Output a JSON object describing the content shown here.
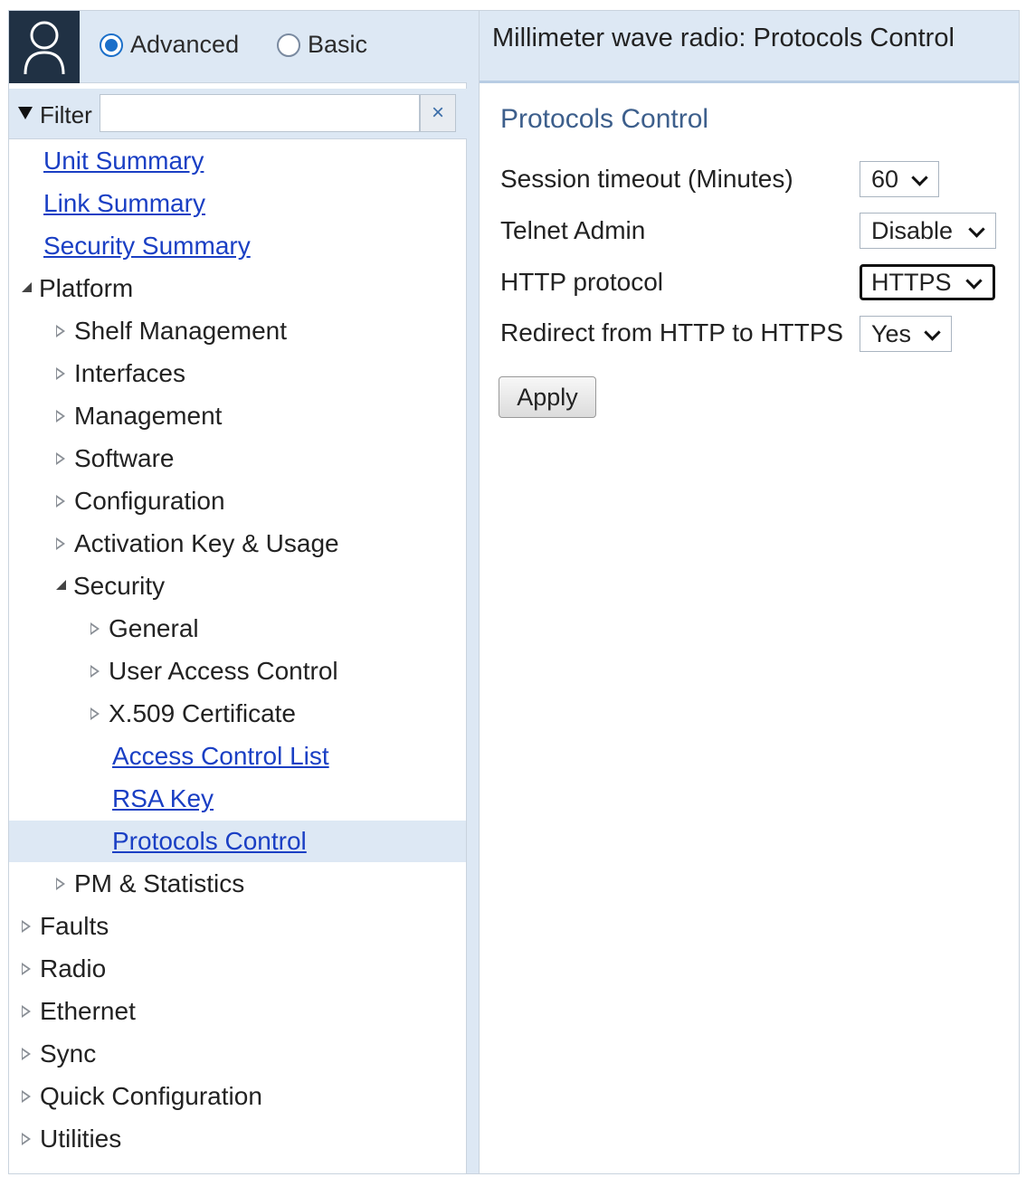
{
  "mode": {
    "advanced_label": "Advanced",
    "basic_label": "Basic",
    "selected": "Advanced"
  },
  "filter": {
    "label": "Filter",
    "value": "",
    "clear_glyph": "×"
  },
  "nav": {
    "unit_summary": "Unit Summary",
    "link_summary": "Link Summary",
    "security_summary": "Security Summary",
    "platform": "Platform",
    "shelf_management": "Shelf Management",
    "interfaces": "Interfaces",
    "management": "Management",
    "software": "Software",
    "configuration": "Configuration",
    "activation_key": "Activation Key & Usage",
    "security": "Security",
    "general": "General",
    "user_access_control": "User Access Control",
    "x509": "X.509 Certificate",
    "acl": "Access Control List",
    "rsa_key": "RSA Key",
    "protocols_control": "Protocols Control",
    "pm_statistics": "PM & Statistics",
    "faults": "Faults",
    "radio": "Radio",
    "ethernet": "Ethernet",
    "sync": "Sync",
    "quick_configuration": "Quick Configuration",
    "utilities": "Utilities",
    "selected": "Protocols Control"
  },
  "content": {
    "page_title": "Millimeter wave radio: Protocols Control",
    "section_title": "Protocols Control",
    "fields": {
      "session_timeout": {
        "label": "Session timeout (Minutes)",
        "value": "60"
      },
      "telnet_admin": {
        "label": "Telnet Admin",
        "value": "Disable"
      },
      "http_protocol": {
        "label": "HTTP protocol",
        "value": "HTTPS"
      },
      "redirect": {
        "label": "Redirect from HTTP to HTTPS",
        "value": "Yes"
      }
    },
    "apply_label": "Apply"
  },
  "colors": {
    "header_bg": "#dde8f4",
    "avatar_bg": "#203144",
    "link": "#1a3fc4",
    "section_title": "#3d5f8c",
    "radio_accent": "#1b6fc9"
  },
  "icons": {
    "avatar": "user-avatar-icon",
    "filter_toggle": "triangle-down-icon",
    "clear": "close-icon"
  }
}
